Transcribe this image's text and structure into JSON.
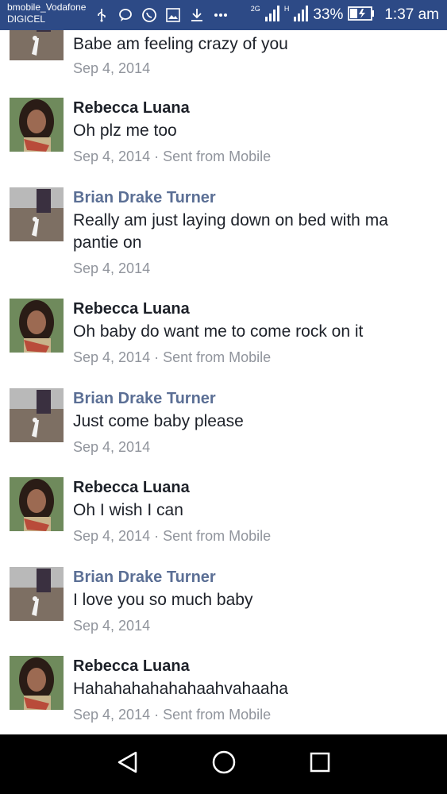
{
  "status_bar": {
    "carrier_primary": "bmobile_Vodafone",
    "carrier_secondary": "DIGICEL",
    "network_2g": "2G",
    "network_h": "H",
    "battery": "33%",
    "time": "1:37 am",
    "icons": [
      "usb-icon",
      "chat-bubble-icon",
      "whatsapp-icon",
      "gallery-icon",
      "download-icon",
      "more-icon",
      "signal-icon",
      "signal-icon",
      "battery-charging-icon"
    ]
  },
  "messages": [
    {
      "sender": "",
      "text": "Babe am feeling crazy of you",
      "meta": "Sep 4, 2014",
      "avatar": "brian"
    },
    {
      "sender": "Rebecca Luana",
      "text": "Oh plz me too",
      "meta": "Sep 4, 2014 · Sent from Mobile",
      "avatar": "rebecca"
    },
    {
      "sender": "Brian Drake Turner",
      "text": "Really am just laying down on bed with ma pantie on",
      "meta": "Sep 4, 2014",
      "avatar": "brian"
    },
    {
      "sender": "Rebecca Luana",
      "text": "Oh baby do want me to come rock on it",
      "meta": "Sep 4, 2014 · Sent from Mobile",
      "avatar": "rebecca"
    },
    {
      "sender": "Brian Drake Turner",
      "text": "Just come baby please",
      "meta": "Sep 4, 2014",
      "avatar": "brian"
    },
    {
      "sender": "Rebecca Luana",
      "text": "Oh I wish I can",
      "meta": "Sep 4, 2014 · Sent from Mobile",
      "avatar": "rebecca"
    },
    {
      "sender": "Brian Drake Turner",
      "text": "I love you so much baby",
      "meta": "Sep 4, 2014",
      "avatar": "brian"
    },
    {
      "sender": "Rebecca Luana",
      "text": "Hahahahahahahaahvahaaha",
      "meta": "Sep 4, 2014 · Sent from Mobile",
      "avatar": "rebecca"
    }
  ],
  "nav_bar": {
    "icons": [
      "back-icon",
      "home-icon",
      "recents-icon"
    ]
  },
  "colors": {
    "status_bar_bg": "#2d4a86",
    "sender_default": "#1d2129",
    "sender_brian": "#5b6f95",
    "meta": "#90949c"
  }
}
